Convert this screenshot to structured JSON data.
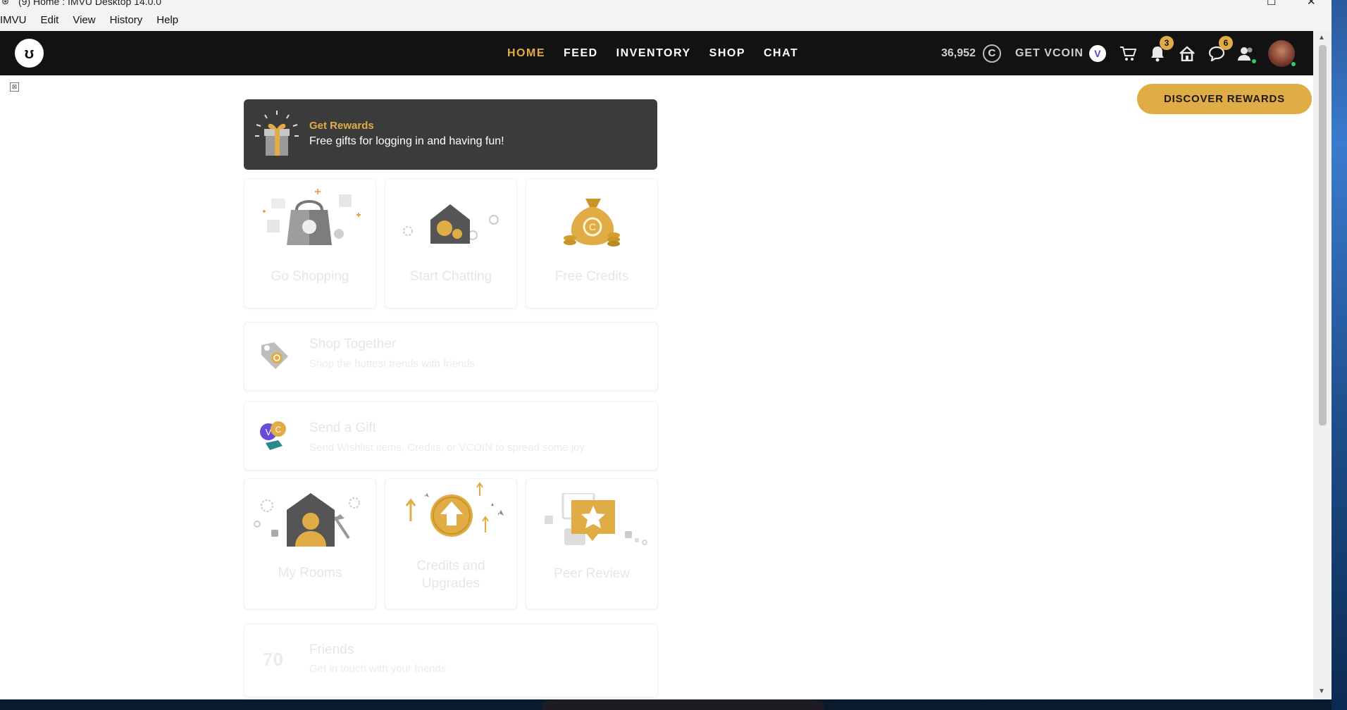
{
  "window": {
    "title": "(9) Home : IMVU Desktop 14.0.0",
    "controls": {
      "maximize": "☐",
      "close": "✕"
    }
  },
  "menubar": [
    "IMVU",
    "Edit",
    "View",
    "History",
    "Help"
  ],
  "nav": {
    "tabs": [
      {
        "label": "HOME",
        "active": true
      },
      {
        "label": "FEED"
      },
      {
        "label": "INVENTORY"
      },
      {
        "label": "SHOP"
      },
      {
        "label": "CHAT"
      }
    ],
    "credits": "36,952",
    "credit_symbol": "C",
    "get_vcoin": "GET VCOIN",
    "vcoin_symbol": "V",
    "notifications_count": "3",
    "messages_count": "6"
  },
  "content": {
    "discover_button": "DISCOVER REWARDS",
    "rewards_banner": {
      "title": "Get Rewards",
      "subtitle": "Free gifts for logging in and having fun!"
    },
    "tiles_row1": [
      {
        "label": "Go Shopping",
        "icon": "shopping-bag-icon"
      },
      {
        "label": "Start Chatting",
        "icon": "chat-house-icon"
      },
      {
        "label": "Free Credits",
        "icon": "money-bag-icon"
      }
    ],
    "shop_together": {
      "title": "Shop Together",
      "subtitle": "Shop the hottest trends with friends"
    },
    "send_gift": {
      "title": "Send a Gift",
      "subtitle": "Send Wishlist items, Credits, or VCOIN to spread some joy"
    },
    "tiles_row2": [
      {
        "label": "My Rooms",
        "icon": "room-house-icon"
      },
      {
        "label": "Credits and Upgrades",
        "icon": "upgrade-arrow-icon"
      },
      {
        "label": "Peer Review",
        "icon": "star-review-icon"
      }
    ],
    "friends": {
      "count": "70",
      "title": "Friends",
      "subtitle": "Get in touch with your friends"
    }
  },
  "colors": {
    "accent": "#e0ac45",
    "nav_bg": "#121212",
    "banner_bg": "#3b3b3b",
    "online": "#2ecc71"
  }
}
